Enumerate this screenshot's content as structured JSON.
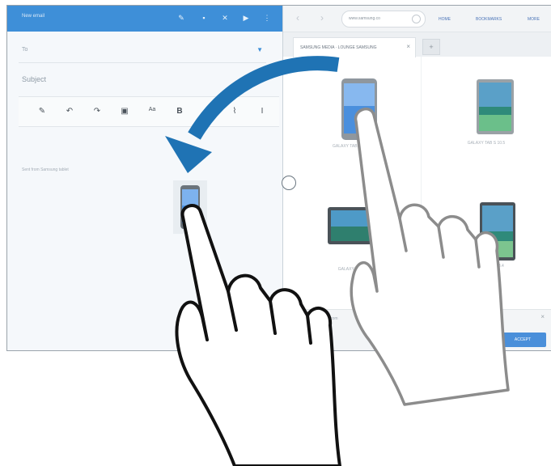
{
  "email": {
    "title": "New email",
    "to_label": "To",
    "subject_label": "Subject",
    "signature": "Sent from Samsung tablet",
    "toolbar": [
      "pen-icon",
      "undo-icon",
      "redo-icon",
      "image-icon",
      "text-icon",
      "bold-icon",
      "italic-icon",
      "clip-icon",
      "text-size-icon"
    ]
  },
  "browser": {
    "url": "www.samsung.co",
    "nav_links": [
      "HOME",
      "BOOKMARKS",
      "MORE"
    ],
    "tab_label": "SAMSUNG MEDIA · LOUNGE SAMSUNG",
    "tab_new": "+",
    "products": [
      {
        "name": "GALAXY TAB S 8.4 (Wi-Fi)"
      },
      {
        "name": "GALAXY TAB S 10.5"
      },
      {
        "name": "GALAXY TAB S 10.5"
      },
      {
        "name": "GALAXY TAB S 8.4"
      }
    ],
    "bottom_url": "http://www.samsung.com",
    "accept_label": "ACCEPT"
  },
  "colors": {
    "accent": "#3e8fd8",
    "arrow": "#1f73b4"
  }
}
